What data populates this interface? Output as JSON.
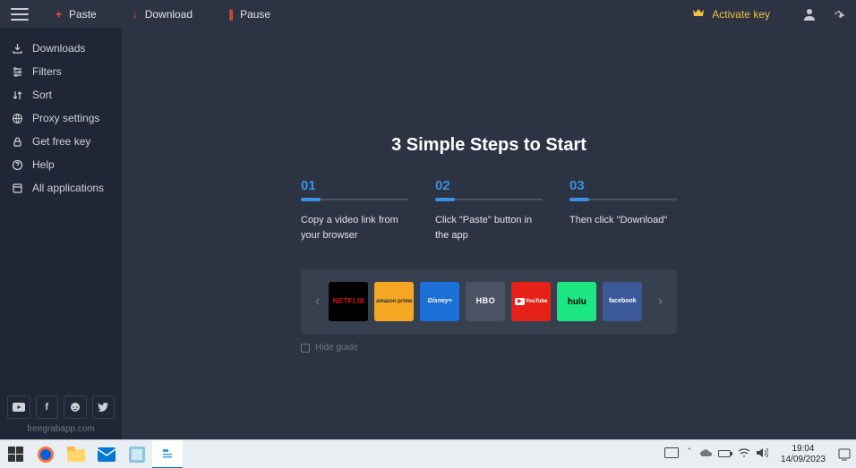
{
  "topbar": {
    "paste": "Paste",
    "download": "Download",
    "pause": "Pause",
    "activate": "Activate key"
  },
  "sidebar": {
    "items": [
      {
        "label": "Downloads"
      },
      {
        "label": "Filters"
      },
      {
        "label": "Sort"
      },
      {
        "label": "Proxy settings"
      },
      {
        "label": "Get free key"
      },
      {
        "label": "Help"
      },
      {
        "label": "All applications"
      }
    ],
    "footer": "freegrabapp.com"
  },
  "guide": {
    "title": "3 Simple Steps to Start",
    "steps": [
      {
        "num": "01",
        "text": "Copy a video link from your browser"
      },
      {
        "num": "02",
        "text": "Click \"Paste\" button in the app"
      },
      {
        "num": "03",
        "text": "Then click \"Download\""
      }
    ],
    "services": [
      {
        "id": "netflix",
        "label": "NETFLIX"
      },
      {
        "id": "amazon",
        "label": "amazon prime"
      },
      {
        "id": "disney",
        "label": "Disney+"
      },
      {
        "id": "hbo",
        "label": "HBO"
      },
      {
        "id": "youtube",
        "label": "YouTube"
      },
      {
        "id": "hulu",
        "label": "hulu"
      },
      {
        "id": "facebook",
        "label": "facebook"
      }
    ],
    "hide": "Hide guide"
  },
  "taskbar": {
    "time": "19:04",
    "date": "14/09/2023"
  }
}
